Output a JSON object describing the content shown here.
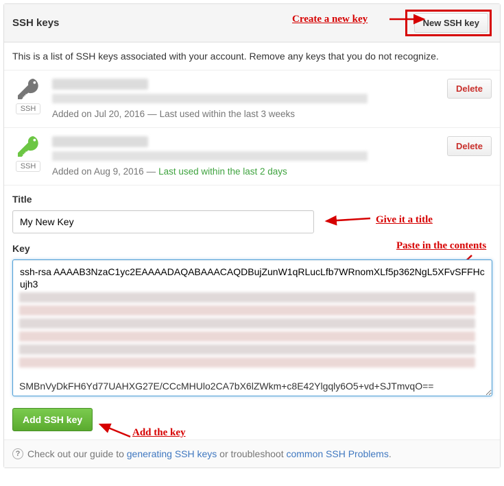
{
  "header": {
    "title": "SSH keys",
    "new_key_button": "New SSH key",
    "annotation_create": "Create a new key"
  },
  "description": "This is a list of SSH keys associated with your account. Remove any keys that you do not recognize.",
  "keys": [
    {
      "badge": "SSH",
      "added_prefix": "Added on ",
      "added_date": "Jul 20, 2016",
      "last_used": "Last used within the last 3 weeks",
      "last_used_recent": false,
      "delete_label": "Delete",
      "icon_color": "#767676"
    },
    {
      "badge": "SSH",
      "added_prefix": "Added on ",
      "added_date": "Aug 9, 2016",
      "last_used": "Last used within the last 2 days",
      "last_used_recent": true,
      "delete_label": "Delete",
      "icon_color": "#6cc644"
    }
  ],
  "form": {
    "title_label": "Title",
    "title_value": "My New Key",
    "key_label": "Key",
    "key_value_visible_top": "ssh-rsa AAAAB3NzaC1yc2EAAAADAQABAAACAQDBujZunW1qRLucLfb7WRnomXLf5p362NgL5XFvSFFHcujh3",
    "key_value_visible_bottom": "SMBnVyDkFH6Yd77UAHXG27E/CCcMHUlo2CA7bX6lZWkm+c8E42Ylgqly6O5+vd+SJTmvqO==",
    "add_button": "Add SSH key",
    "annotation_title": "Give it a title",
    "annotation_paste": "Paste in the contents",
    "annotation_add": "Add the key"
  },
  "footer": {
    "text_prefix": "Check out our guide to ",
    "link1": "generating SSH keys",
    "text_mid": " or troubleshoot ",
    "link2": "common SSH Problems",
    "text_suffix": "."
  }
}
